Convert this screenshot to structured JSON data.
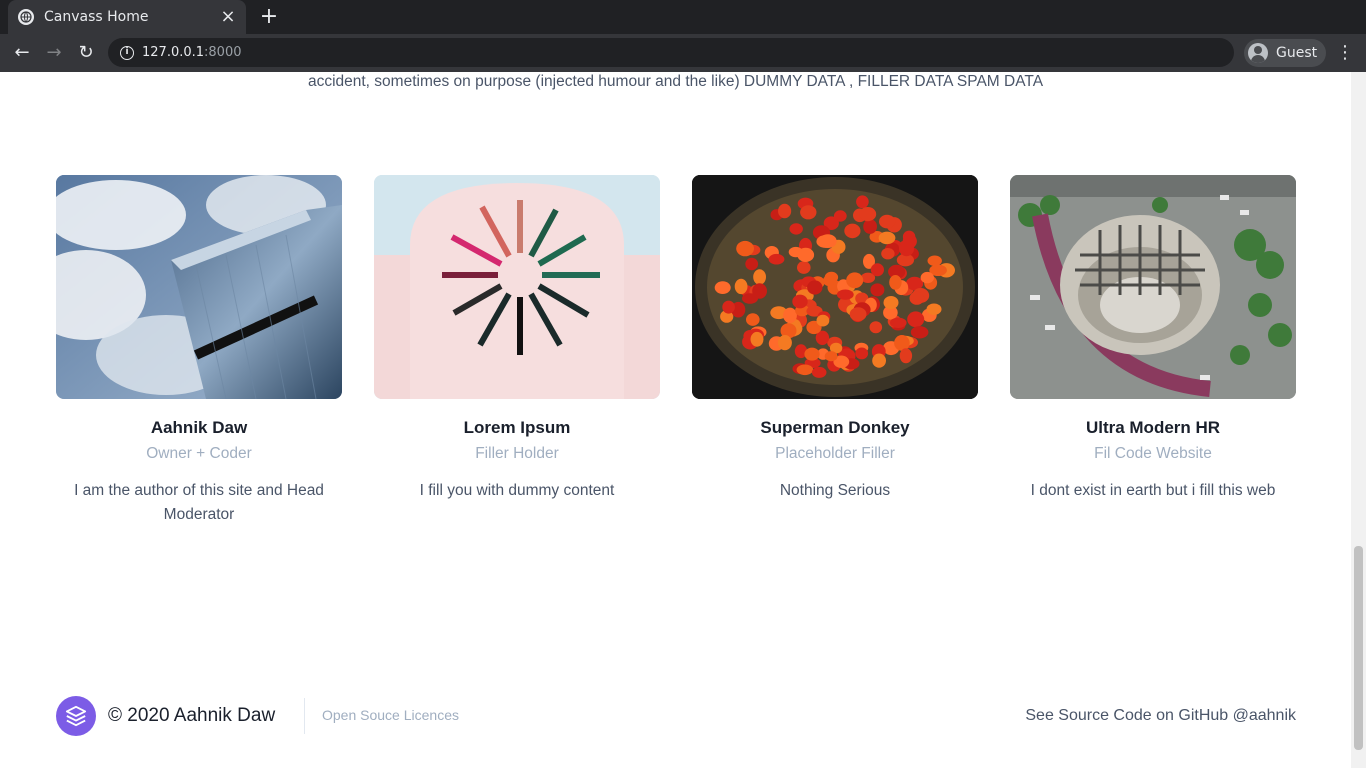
{
  "browser": {
    "tab_title": "Canvass Home",
    "tab_close": "×",
    "new_tab": "+",
    "url_host": "127.0.0.1",
    "url_port": ":8000",
    "profile_label": "Guest",
    "back": "←",
    "forward": "→",
    "reload": "↻",
    "menu": "⋮"
  },
  "intro": {
    "text": "accident, sometimes on purpose (injected humour and the like) DUMMY DATA , FILLER DATA SPAM DATA"
  },
  "team": [
    {
      "name": "Aahnik Daw",
      "role": "Owner + Coder",
      "desc": "I am the author of this site and Head Moderator",
      "image": "glass-skyscraper-clouds"
    },
    {
      "name": "Lorem Ipsum",
      "role": "Filler Holder",
      "desc": "I fill you with dummy content",
      "image": "pink-arch-sunburst"
    },
    {
      "name": "Superman Donkey",
      "role": "Placeholder Filler",
      "desc": "Nothing Serious",
      "image": "basket-of-tomatoes"
    },
    {
      "name": "Ultra Modern HR",
      "role": "Fil Code Website",
      "desc": "I dont exist in earth but i fill this web",
      "image": "aerial-city-building"
    }
  ],
  "footer": {
    "copyright": "© 2020 Aahnik Daw",
    "licences": "Open Souce Licences",
    "source": "See Source Code on GitHub @aahnik",
    "logo_icon": "layers-icon",
    "logo_color": "#7c5ce6"
  }
}
